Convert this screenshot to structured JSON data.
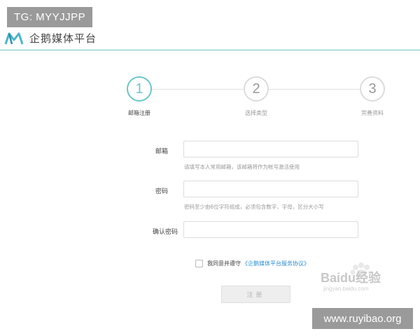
{
  "overlay": {
    "tg_badge": "TG: MYYJJPP",
    "site_badge": "www.ruyibao.org"
  },
  "header": {
    "brand_name": "企鹅媒体平台",
    "logo_icon": "brand-logo-icon",
    "accent_color": "#6cc5c9"
  },
  "steps": [
    {
      "number": "1",
      "label": "邮箱注册",
      "active": true
    },
    {
      "number": "2",
      "label": "选择类型",
      "active": false
    },
    {
      "number": "3",
      "label": "完善资料",
      "active": false
    }
  ],
  "form": {
    "email": {
      "label": "邮箱",
      "value": "",
      "hint": "请填写本人常用邮箱，该邮箱将作为帐号激活使用"
    },
    "password": {
      "label": "密码",
      "value": "",
      "hint": "密码至少由6位字符组成，必须包含数字、字母，区分大小写"
    },
    "confirm_password": {
      "label": "确认密码",
      "value": ""
    },
    "agree": {
      "text": "我同意并遵守",
      "link": "《企鹅媒体平台服务协议》",
      "checked": false
    },
    "submit_label": "注册"
  },
  "watermark": {
    "text": "Baidu经验",
    "sub": "jingyan.baidu.com"
  }
}
